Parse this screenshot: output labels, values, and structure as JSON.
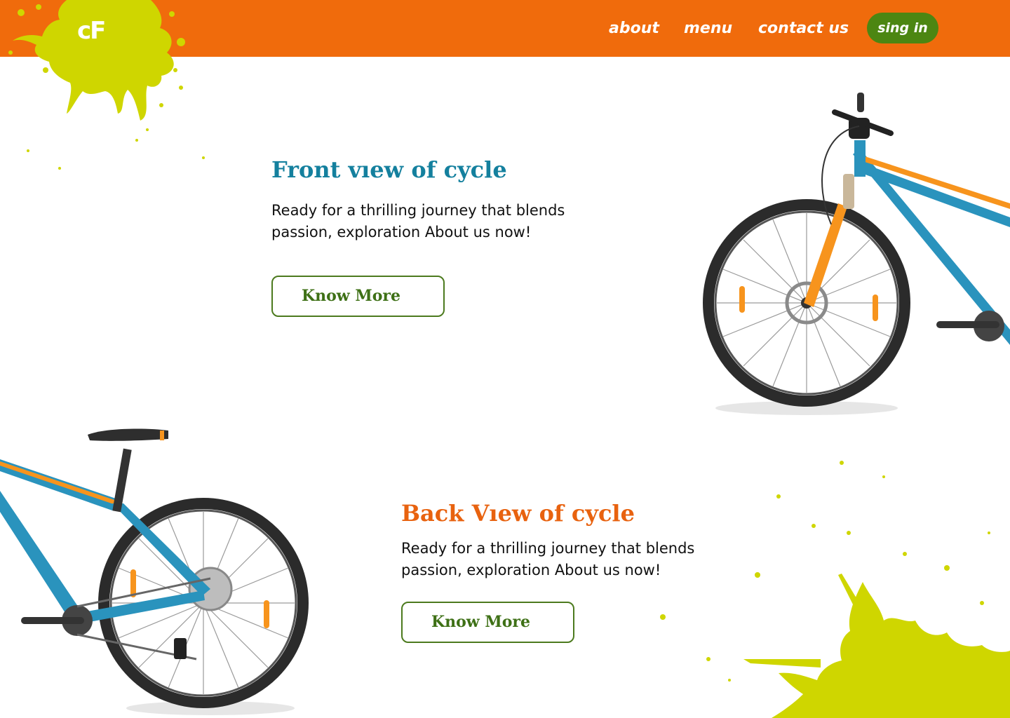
{
  "header": {
    "logo_text": "cF",
    "nav": [
      {
        "label": "about"
      },
      {
        "label": "menu"
      },
      {
        "label": "contact us"
      }
    ],
    "signin_label": "sing in"
  },
  "sections": [
    {
      "title": "Front vıew of cycle",
      "text": "Ready for a thrilling  journey that blends passion, exploration About us now!",
      "button_label": "Know More",
      "image": "bike-front-image"
    },
    {
      "title": "Back Vıew of cycle",
      "text": "Ready for a thrilling  journey that blends passion, exploration About us now!",
      "button_label": "Know More",
      "image": "bike-back-image"
    }
  ],
  "colors": {
    "header_bg": "#f06b0c",
    "splat": "#cfd600",
    "signin_bg": "#4c8612",
    "front_title": "#14809e",
    "back_title": "#e8620f",
    "button_border": "#4c7a1e",
    "bike_frame": "#2a93bd",
    "bike_accent": "#f7941d"
  }
}
